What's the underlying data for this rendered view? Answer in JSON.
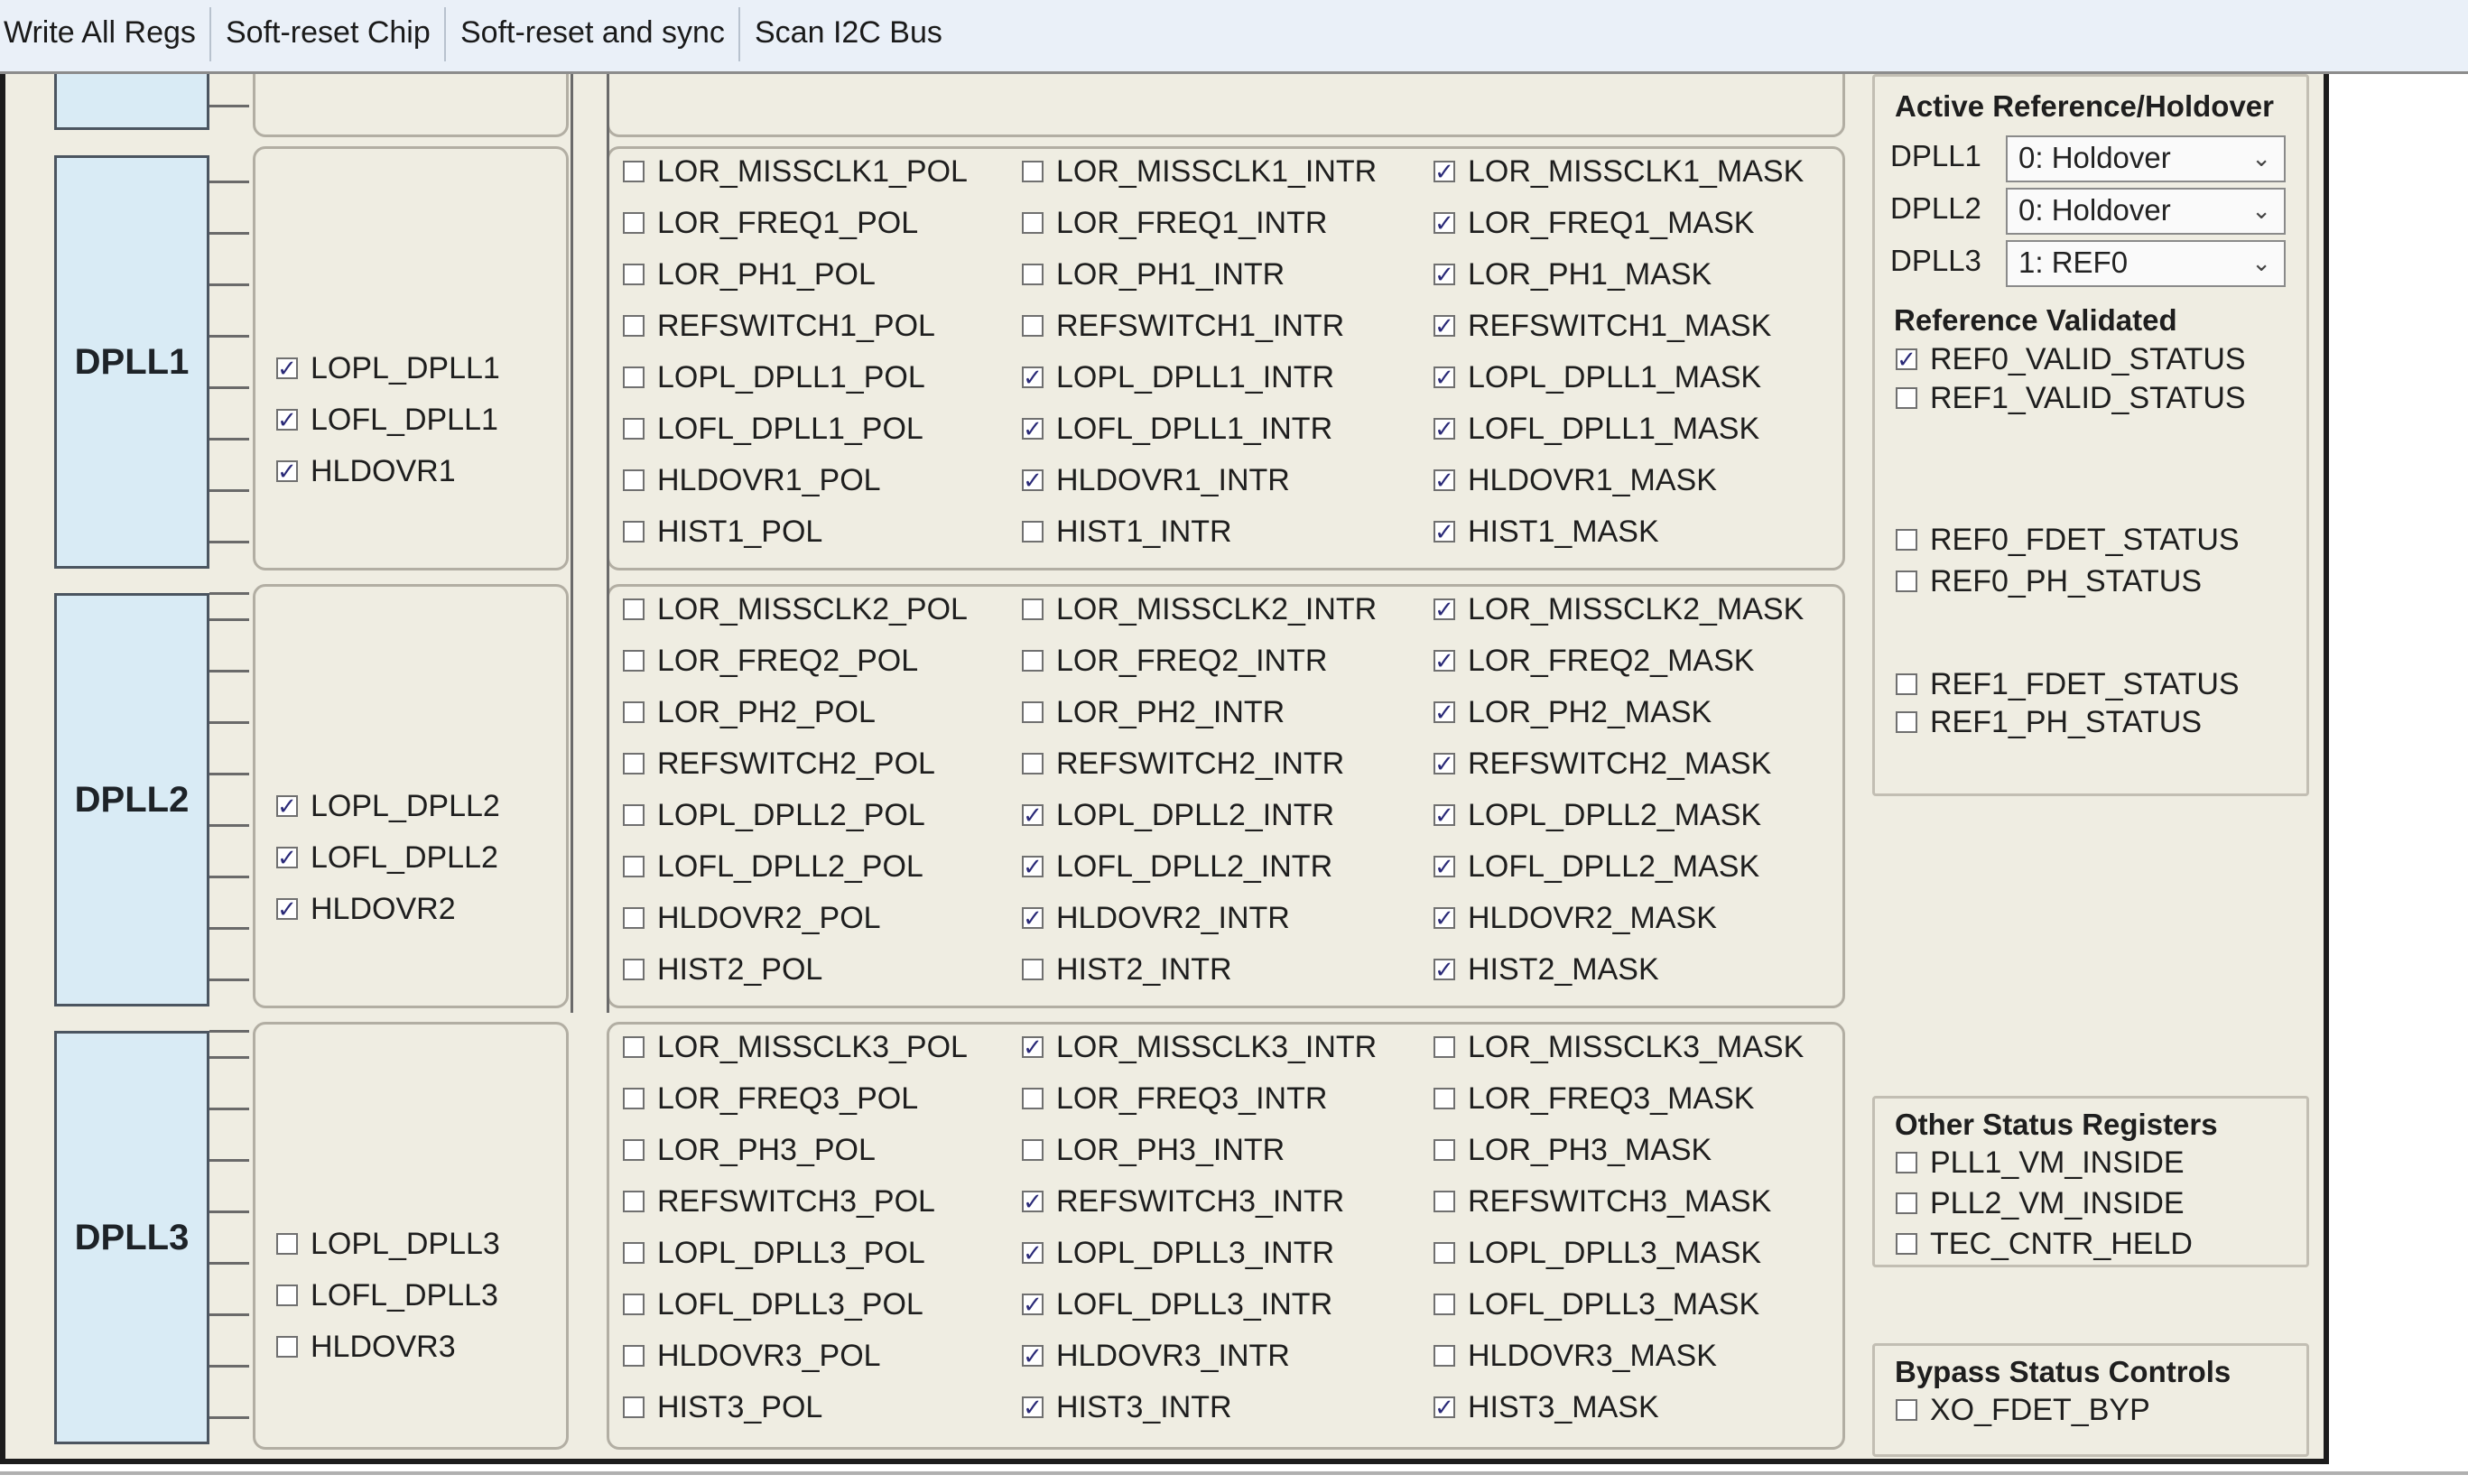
{
  "toolbar": {
    "buttons": [
      "Write All Regs",
      "Soft-reset Chip",
      "Soft-reset and sync",
      "Scan I2C Bus"
    ]
  },
  "dplls": [
    {
      "label": "DPLL1",
      "status": [
        {
          "name": "LOPL_DPLL1",
          "checked": true
        },
        {
          "name": "LOFL_DPLL1",
          "checked": true
        },
        {
          "name": "HLDOVR1",
          "checked": true
        }
      ],
      "pol": [
        {
          "name": "LOR_MISSCLK1_POL",
          "checked": false
        },
        {
          "name": "LOR_FREQ1_POL",
          "checked": false
        },
        {
          "name": "LOR_PH1_POL",
          "checked": false
        },
        {
          "name": "REFSWITCH1_POL",
          "checked": false
        },
        {
          "name": "LOPL_DPLL1_POL",
          "checked": false
        },
        {
          "name": "LOFL_DPLL1_POL",
          "checked": false
        },
        {
          "name": "HLDOVR1_POL",
          "checked": false
        },
        {
          "name": "HIST1_POL",
          "checked": false
        }
      ],
      "intr": [
        {
          "name": "LOR_MISSCLK1_INTR",
          "checked": false
        },
        {
          "name": "LOR_FREQ1_INTR",
          "checked": false
        },
        {
          "name": "LOR_PH1_INTR",
          "checked": false
        },
        {
          "name": "REFSWITCH1_INTR",
          "checked": false
        },
        {
          "name": "LOPL_DPLL1_INTR",
          "checked": true
        },
        {
          "name": "LOFL_DPLL1_INTR",
          "checked": true
        },
        {
          "name": "HLDOVR1_INTR",
          "checked": true
        },
        {
          "name": "HIST1_INTR",
          "checked": false
        }
      ],
      "mask": [
        {
          "name": "LOR_MISSCLK1_MASK",
          "checked": true
        },
        {
          "name": "LOR_FREQ1_MASK",
          "checked": true
        },
        {
          "name": "LOR_PH1_MASK",
          "checked": true
        },
        {
          "name": "REFSWITCH1_MASK",
          "checked": true
        },
        {
          "name": "LOPL_DPLL1_MASK",
          "checked": true
        },
        {
          "name": "LOFL_DPLL1_MASK",
          "checked": true
        },
        {
          "name": "HLDOVR1_MASK",
          "checked": true
        },
        {
          "name": "HIST1_MASK",
          "checked": true
        }
      ]
    },
    {
      "label": "DPLL2",
      "status": [
        {
          "name": "LOPL_DPLL2",
          "checked": true
        },
        {
          "name": "LOFL_DPLL2",
          "checked": true
        },
        {
          "name": "HLDOVR2",
          "checked": true
        }
      ],
      "pol": [
        {
          "name": "LOR_MISSCLK2_POL",
          "checked": false
        },
        {
          "name": "LOR_FREQ2_POL",
          "checked": false
        },
        {
          "name": "LOR_PH2_POL",
          "checked": false
        },
        {
          "name": "REFSWITCH2_POL",
          "checked": false
        },
        {
          "name": "LOPL_DPLL2_POL",
          "checked": false
        },
        {
          "name": "LOFL_DPLL2_POL",
          "checked": false
        },
        {
          "name": "HLDOVR2_POL",
          "checked": false
        },
        {
          "name": "HIST2_POL",
          "checked": false
        }
      ],
      "intr": [
        {
          "name": "LOR_MISSCLK2_INTR",
          "checked": false
        },
        {
          "name": "LOR_FREQ2_INTR",
          "checked": false
        },
        {
          "name": "LOR_PH2_INTR",
          "checked": false
        },
        {
          "name": "REFSWITCH2_INTR",
          "checked": false
        },
        {
          "name": "LOPL_DPLL2_INTR",
          "checked": true
        },
        {
          "name": "LOFL_DPLL2_INTR",
          "checked": true
        },
        {
          "name": "HLDOVR2_INTR",
          "checked": true
        },
        {
          "name": "HIST2_INTR",
          "checked": false
        }
      ],
      "mask": [
        {
          "name": "LOR_MISSCLK2_MASK",
          "checked": true
        },
        {
          "name": "LOR_FREQ2_MASK",
          "checked": true
        },
        {
          "name": "LOR_PH2_MASK",
          "checked": true
        },
        {
          "name": "REFSWITCH2_MASK",
          "checked": true
        },
        {
          "name": "LOPL_DPLL2_MASK",
          "checked": true
        },
        {
          "name": "LOFL_DPLL2_MASK",
          "checked": true
        },
        {
          "name": "HLDOVR2_MASK",
          "checked": true
        },
        {
          "name": "HIST2_MASK",
          "checked": true
        }
      ]
    },
    {
      "label": "DPLL3",
      "status": [
        {
          "name": "LOPL_DPLL3",
          "checked": false
        },
        {
          "name": "LOFL_DPLL3",
          "checked": false
        },
        {
          "name": "HLDOVR3",
          "checked": false
        }
      ],
      "pol": [
        {
          "name": "LOR_MISSCLK3_POL",
          "checked": false
        },
        {
          "name": "LOR_FREQ3_POL",
          "checked": false
        },
        {
          "name": "LOR_PH3_POL",
          "checked": false
        },
        {
          "name": "REFSWITCH3_POL",
          "checked": false
        },
        {
          "name": "LOPL_DPLL3_POL",
          "checked": false
        },
        {
          "name": "LOFL_DPLL3_POL",
          "checked": false
        },
        {
          "name": "HLDOVR3_POL",
          "checked": false
        },
        {
          "name": "HIST3_POL",
          "checked": false
        }
      ],
      "intr": [
        {
          "name": "LOR_MISSCLK3_INTR",
          "checked": true
        },
        {
          "name": "LOR_FREQ3_INTR",
          "checked": false
        },
        {
          "name": "LOR_PH3_INTR",
          "checked": false
        },
        {
          "name": "REFSWITCH3_INTR",
          "checked": true
        },
        {
          "name": "LOPL_DPLL3_INTR",
          "checked": true
        },
        {
          "name": "LOFL_DPLL3_INTR",
          "checked": true
        },
        {
          "name": "HLDOVR3_INTR",
          "checked": true
        },
        {
          "name": "HIST3_INTR",
          "checked": true
        }
      ],
      "mask": [
        {
          "name": "LOR_MISSCLK3_MASK",
          "checked": false
        },
        {
          "name": "LOR_FREQ3_MASK",
          "checked": false
        },
        {
          "name": "LOR_PH3_MASK",
          "checked": false
        },
        {
          "name": "REFSWITCH3_MASK",
          "checked": false
        },
        {
          "name": "LOPL_DPLL3_MASK",
          "checked": false
        },
        {
          "name": "LOFL_DPLL3_MASK",
          "checked": false
        },
        {
          "name": "HLDOVR3_MASK",
          "checked": false
        },
        {
          "name": "HIST3_MASK",
          "checked": true
        }
      ]
    }
  ],
  "active_ref": {
    "title": "Active Reference/Holdover",
    "rows": [
      {
        "label": "DPLL1",
        "value": "0: Holdover"
      },
      {
        "label": "DPLL2",
        "value": "0: Holdover"
      },
      {
        "label": "DPLL3",
        "value": "1: REF0"
      }
    ],
    "validated_title": "Reference Validated",
    "validated": [
      {
        "name": "REF0_VALID_STATUS",
        "checked": true
      },
      {
        "name": "REF1_VALID_STATUS",
        "checked": false
      }
    ],
    "ref0": [
      {
        "name": "REF0_FDET_STATUS",
        "checked": false
      },
      {
        "name": "REF0_PH_STATUS",
        "checked": false
      }
    ],
    "ref1": [
      {
        "name": "REF1_FDET_STATUS",
        "checked": false
      },
      {
        "name": "REF1_PH_STATUS",
        "checked": false
      }
    ]
  },
  "other_status": {
    "title": "Other Status Registers",
    "items": [
      {
        "name": "PLL1_VM_INSIDE",
        "checked": false
      },
      {
        "name": "PLL2_VM_INSIDE",
        "checked": false
      },
      {
        "name": "TEC_CNTR_HELD",
        "checked": false
      }
    ]
  },
  "bypass": {
    "title": "Bypass Status Controls",
    "items": [
      {
        "name": "XO_FDET_BYP",
        "checked": false
      }
    ]
  },
  "colors": {
    "panel_bg": "#efede2",
    "dpll_box": "#d9ebf5",
    "toolbar_bg": "#eaf0f8",
    "check": "#2a2a78"
  }
}
